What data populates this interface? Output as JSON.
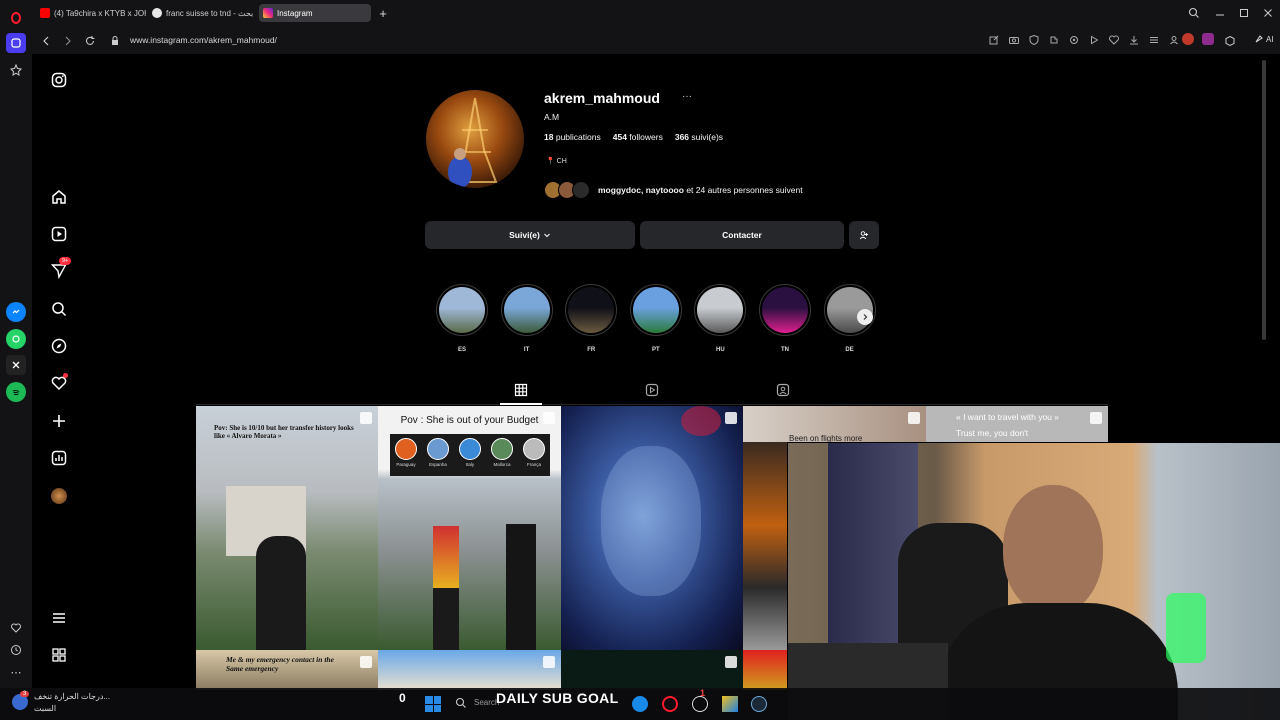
{
  "browser": {
    "tabs": [
      {
        "label": "(4) Ta9chira x KTYB x JOH",
        "favicon_color": "#ff0000"
      },
      {
        "label": "franc suisse to tnd - بحث",
        "favicon_color": "#e8e8e8"
      },
      {
        "label": "Instagram",
        "favicon_color": "#e1306c"
      }
    ],
    "url": "www.instagram.com/akrem_mahmoud/",
    "ai_label": "AI"
  },
  "profile": {
    "username": "akrem_mahmoud",
    "more": "···",
    "full_name": "A.M",
    "posts_count": "18",
    "posts_label": "publications",
    "followers_count": "454",
    "followers_label": "followers",
    "following_count": "366",
    "following_label": "suivi(e)s",
    "location": "CH",
    "followed_by_names": "moggydoc, naytoooo",
    "followed_by_rest": " et 24 autres personnes suivent"
  },
  "actions": {
    "follow_label": "Suivi(e)",
    "contact_label": "Contacter"
  },
  "highlights": [
    {
      "label": "ES",
      "color_a": "#9fb8d8",
      "color_b": "#5a6a4a"
    },
    {
      "label": "IT",
      "color_a": "#7aa6d8",
      "color_b": "#3c5a3a"
    },
    {
      "label": "FR",
      "color_a": "#101018",
      "color_b": "#6a5a40"
    },
    {
      "label": "PT",
      "color_a": "#6aa0e0",
      "color_b": "#2a7a3a"
    },
    {
      "label": "HU",
      "color_a": "#c8ccd0",
      "color_b": "#5a5a5a"
    },
    {
      "label": "TN",
      "color_a": "#2a1040",
      "color_b": "#e02090"
    },
    {
      "label": "DE",
      "color_a": "#9a9a9a",
      "color_b": "#4a4a4a"
    }
  ],
  "posts": [
    {
      "caption": "Pov: She is 10/10 but her transfer history looks like « Alvaro Morata »"
    },
    {
      "caption": "Pov : She is out of your Budget",
      "countries": [
        "Paraguay",
        "Espanha",
        "Italy",
        "Mallorca",
        "França"
      ]
    },
    {
      "caption": ""
    },
    {
      "caption": "Been on flights more"
    },
    {
      "caption": "« I want to travel with you » Trust me, you don't"
    },
    {
      "caption": "Me & my emergency contact in the Same emergency"
    }
  ],
  "taskbar": {
    "weather_badge": "3",
    "weather_line1": "درجات الحرارة تنخف...",
    "weather_line2": "السبت",
    "score": "0",
    "goal_label": "DAILY SUB GOAL",
    "search_placeholder": "Search",
    "red_count": "1"
  },
  "colors": {
    "rail_bg": "#131316",
    "button_bg": "#26272b",
    "notification_red": "#ff3040"
  }
}
